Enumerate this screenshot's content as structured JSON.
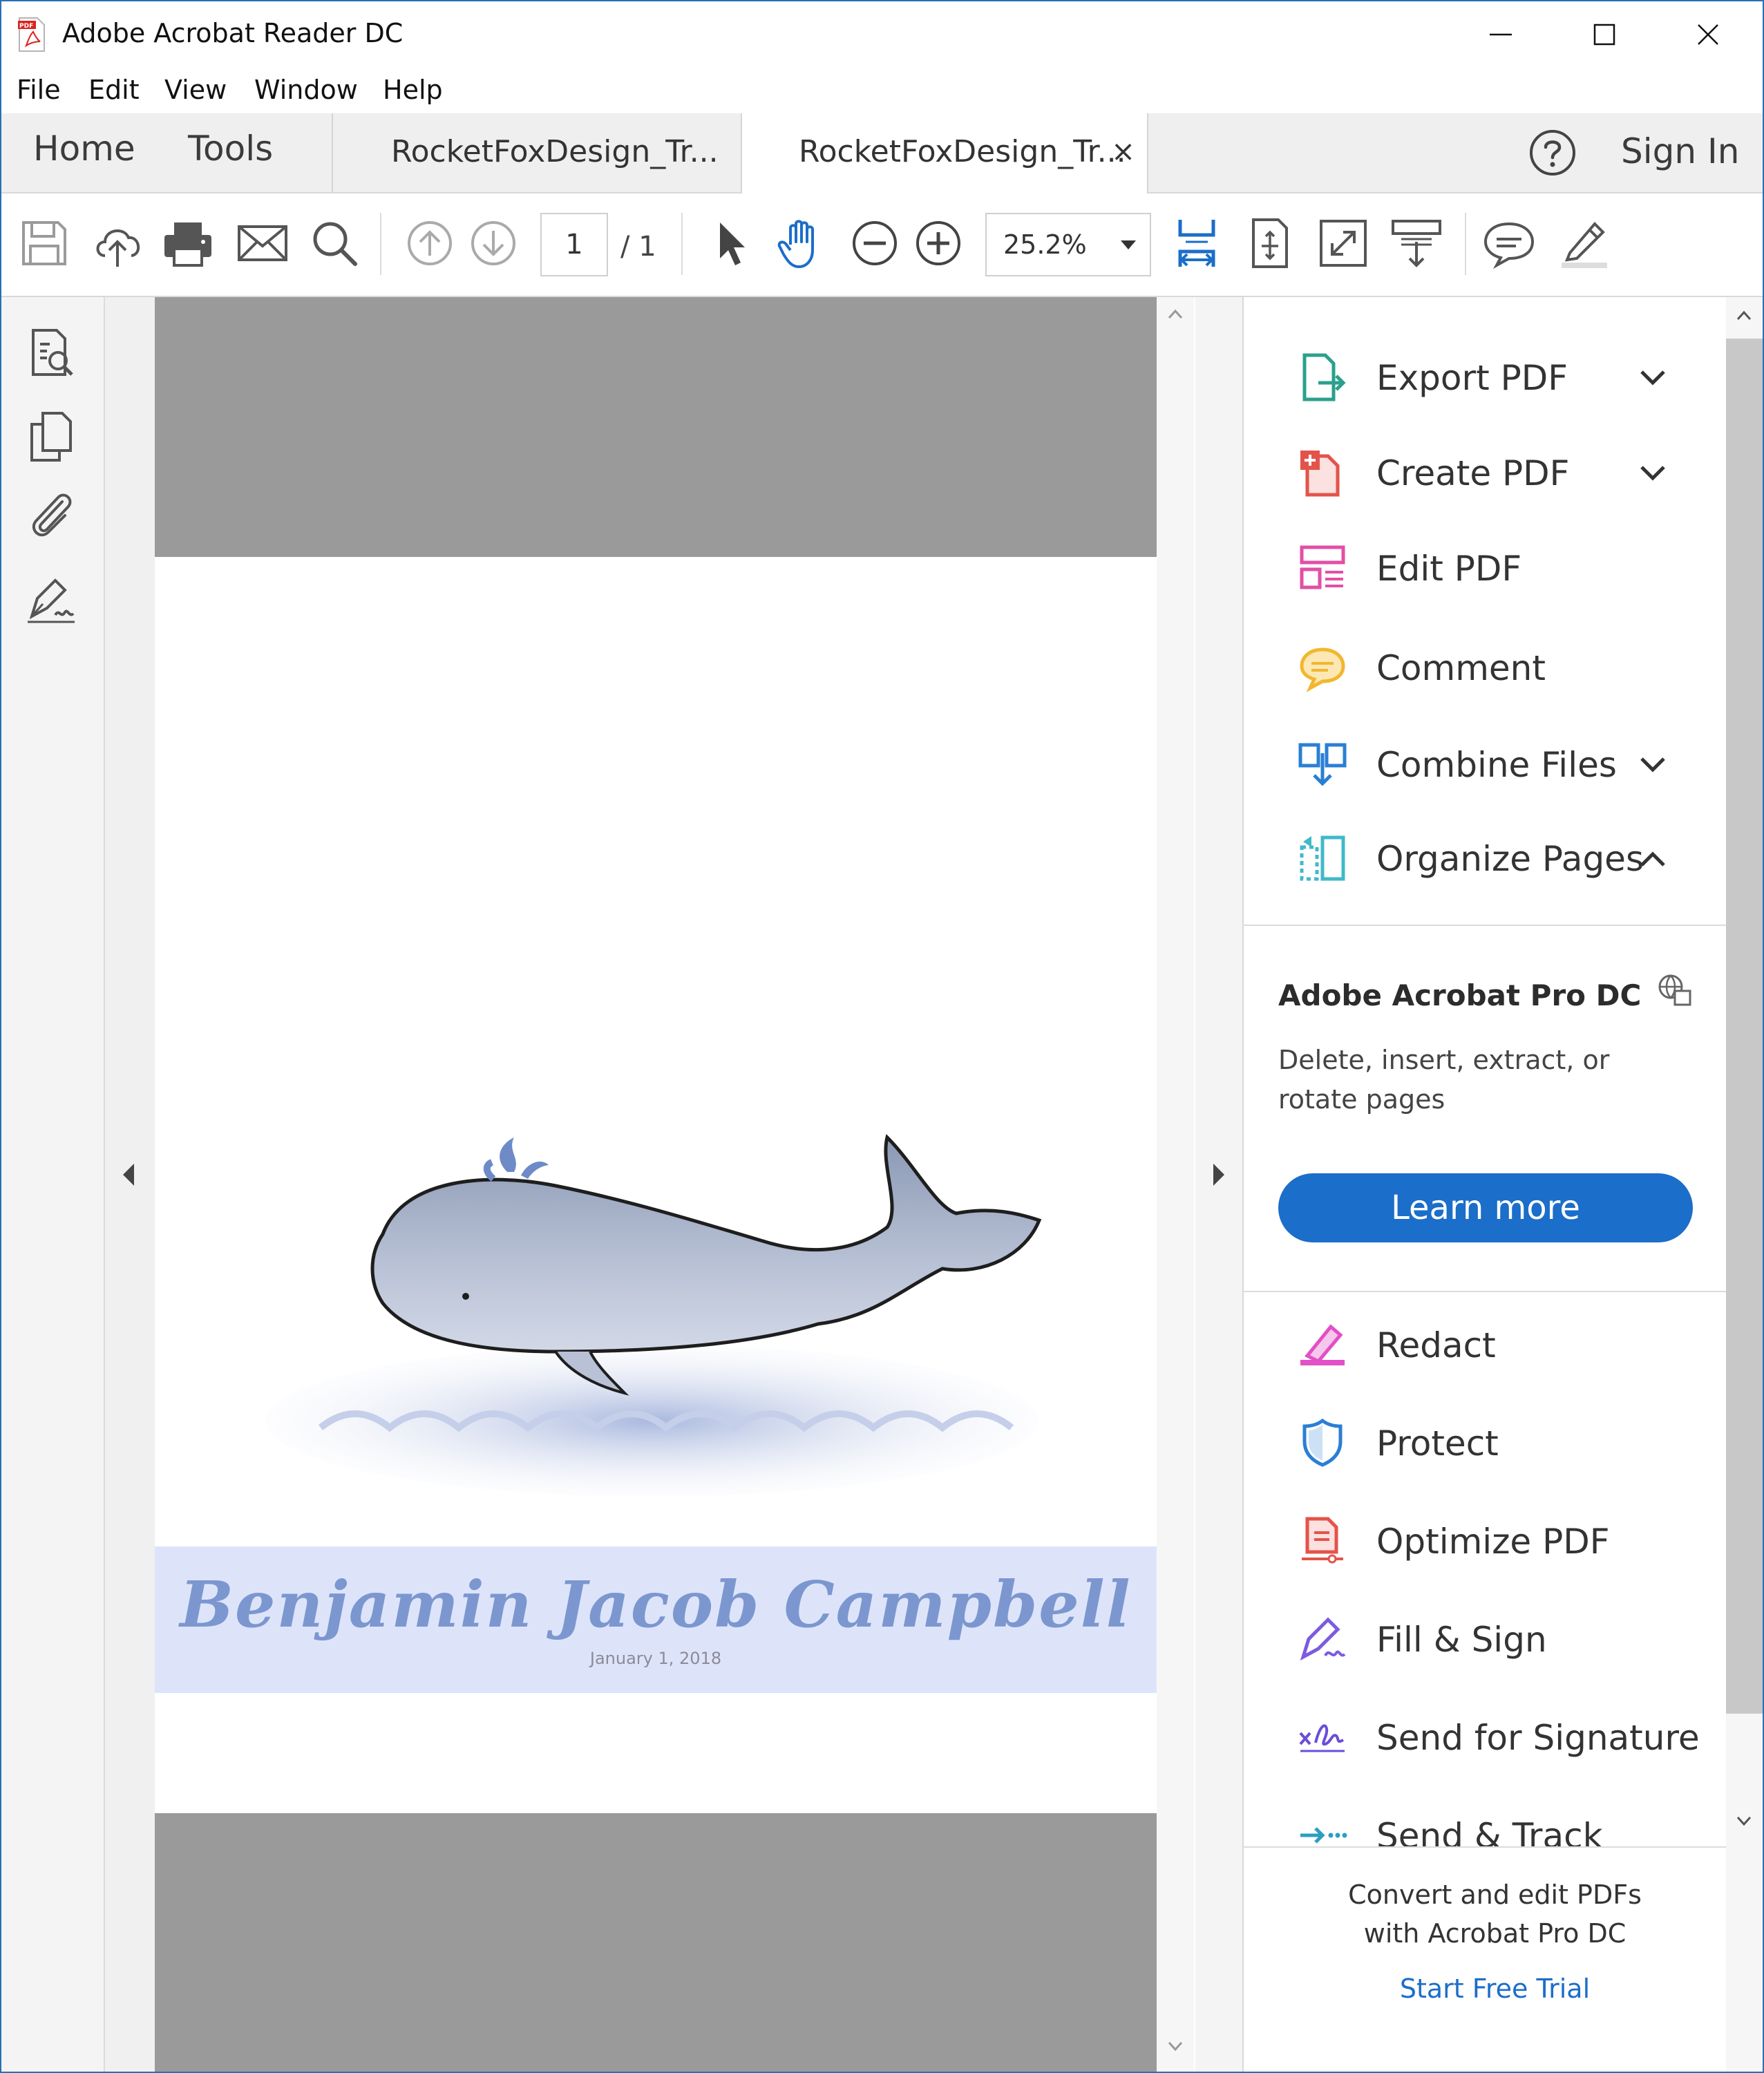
{
  "window": {
    "title": "Adobe Acrobat Reader DC",
    "controls": [
      "minimize-icon",
      "maximize-icon",
      "close-icon"
    ]
  },
  "menu": {
    "items": [
      "File",
      "Edit",
      "View",
      "Window",
      "Help"
    ]
  },
  "tabs": {
    "home": "Home",
    "tools": "Tools",
    "doc_tabs": [
      "RocketFoxDesign_Tr...",
      "RocketFoxDesign_Tr..."
    ],
    "close_glyph": "×",
    "help_icon": "question-icon",
    "sign_in": "Sign In"
  },
  "toolbar": {
    "icons": [
      "save-icon",
      "cloud-upload-icon",
      "print-icon",
      "mail-icon",
      "search-icon",
      "page-up-icon",
      "page-down-icon",
      "select-arrow-icon",
      "hand-icon",
      "zoom-out-icon",
      "zoom-in-icon",
      "fit-width-icon",
      "fit-page-icon",
      "full-screen-icon",
      "scroll-mode-icon",
      "comment-icon",
      "highlight-pen-icon"
    ],
    "page_current": "1",
    "page_total": "/  1",
    "zoom": "25.2%"
  },
  "left_sidebar": {
    "icons": [
      "page-thumbnails-icon",
      "copy-pages-icon",
      "attachment-icon",
      "signature-pen-icon"
    ]
  },
  "document": {
    "name": "Benjamin Jacob Campbell",
    "date": "January 1, 2018",
    "colors": {
      "band": "#dde4fa",
      "name": "#7c97cf",
      "gray": "#9a9a9a"
    },
    "illustration": "whale-illustration"
  },
  "tools_panel": {
    "top_tools": [
      {
        "label": "Export PDF",
        "icon": "export-pdf-icon",
        "chevron": "down"
      },
      {
        "label": "Create PDF",
        "icon": "create-pdf-icon",
        "chevron": "down"
      },
      {
        "label": "Edit PDF",
        "icon": "edit-pdf-icon",
        "chevron": ""
      },
      {
        "label": "Comment",
        "icon": "comment-bubble-icon",
        "chevron": ""
      },
      {
        "label": "Combine Files",
        "icon": "combine-files-icon",
        "chevron": "down"
      },
      {
        "label": "Organize Pages",
        "icon": "organize-pages-icon",
        "chevron": "up"
      }
    ],
    "promo": {
      "title": "Adobe Acrobat Pro DC",
      "description": "Delete, insert, extract, or rotate pages",
      "button": "Learn more",
      "globe_icon": "globe-icon"
    },
    "more_tools": [
      {
        "label": "Redact",
        "icon": "redact-icon"
      },
      {
        "label": "Protect",
        "icon": "shield-icon"
      },
      {
        "label": "Optimize PDF",
        "icon": "optimize-pdf-icon"
      },
      {
        "label": "Fill & Sign",
        "icon": "fill-sign-icon"
      },
      {
        "label": "Send for Signature",
        "icon": "send-signature-icon"
      },
      {
        "label": "Send & Track",
        "icon": "send-track-icon"
      }
    ],
    "footer": {
      "line1": "Convert and edit PDFs",
      "line2": "with Acrobat Pro DC",
      "link": "Start Free Trial"
    }
  }
}
